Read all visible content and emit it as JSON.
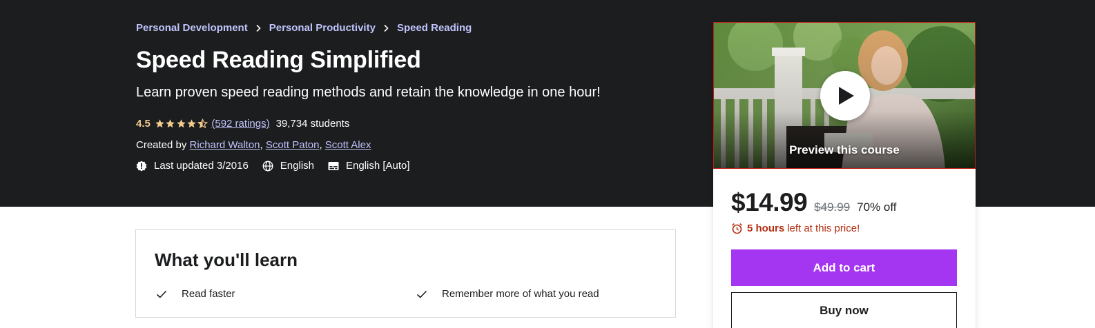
{
  "breadcrumb": {
    "items": [
      "Personal Development",
      "Personal Productivity",
      "Speed Reading"
    ]
  },
  "course": {
    "title": "Speed Reading Simplified",
    "subtitle": "Learn proven speed reading methods and retain the knowledge in one hour!",
    "rating": "4.5",
    "rating_stars": 4.5,
    "ratings_count": "(592 ratings)",
    "students": "39,734 students",
    "created_by_label": "Created by",
    "instructors": [
      "Richard Walton",
      "Scott Paton",
      "Scott Alex"
    ],
    "last_updated": "Last updated 3/2016",
    "language": "English",
    "captions": "English [Auto]"
  },
  "sidebar": {
    "preview_label": "Preview this course",
    "price_current": "$14.99",
    "price_original": "$49.99",
    "discount": "70% off",
    "timer_bold": "5 hours",
    "timer_rest": "left at this price!",
    "add_to_cart": "Add to cart",
    "buy_now": "Buy now"
  },
  "learn": {
    "title": "What you'll learn",
    "items": [
      "Read faster",
      "Remember more of what you read"
    ]
  },
  "colors": {
    "hero_bg": "#1c1d1f",
    "link_purple": "#c0c4fc",
    "star_gold": "#f3ca8c",
    "cta_purple": "#a435f0",
    "timer_red": "#b32d0f"
  },
  "icons": [
    "chevron-right-icon",
    "star-icon",
    "half-star-icon",
    "alert-badge-icon",
    "globe-icon",
    "captions-icon",
    "play-icon",
    "alarm-clock-icon",
    "check-icon"
  ]
}
